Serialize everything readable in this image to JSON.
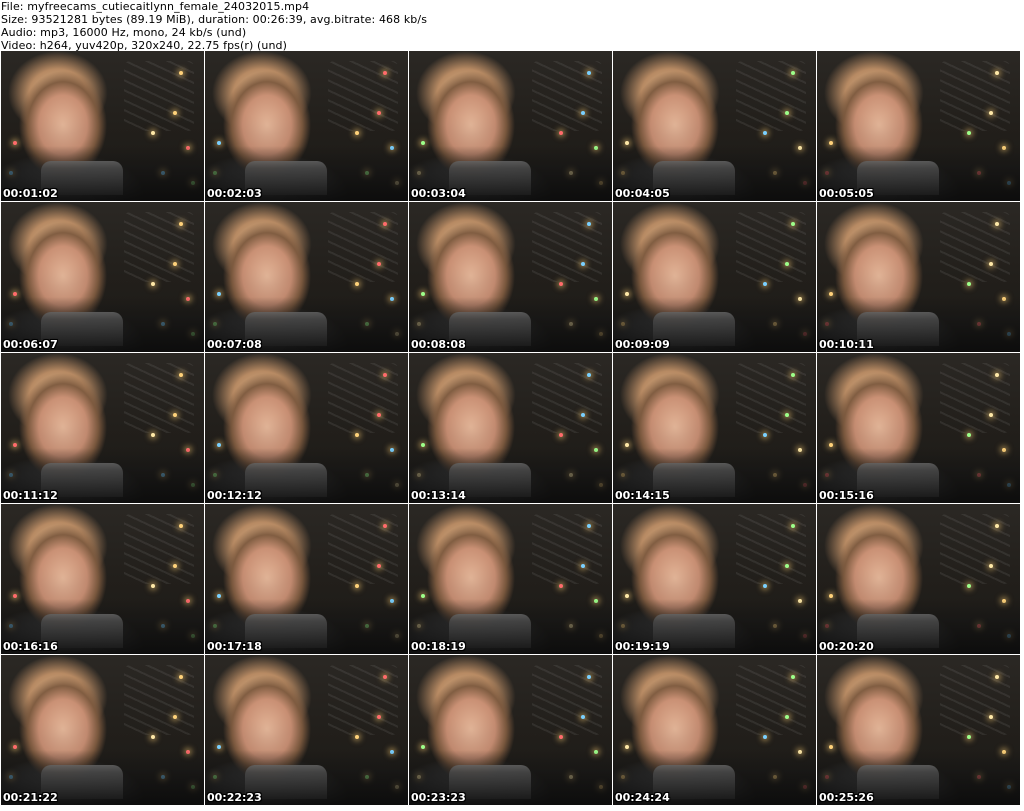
{
  "header": {
    "file": "File: myfreecams_cutiecaitlynn_female_24032015.mp4",
    "size": "Size: 93521281 bytes (89.19 MiB), duration: 00:26:39, avg.bitrate: 468 kb/s",
    "audio": "Audio: mp3, 16000 Hz, mono, 24 kb/s (und)",
    "video": "Video: h264, yuv420p, 320x240, 22.75 fps(r) (und)"
  },
  "thumbnails": [
    {
      "timestamp": "00:01:02"
    },
    {
      "timestamp": "00:02:03"
    },
    {
      "timestamp": "00:03:04"
    },
    {
      "timestamp": "00:04:05"
    },
    {
      "timestamp": "00:05:05"
    },
    {
      "timestamp": "00:06:07"
    },
    {
      "timestamp": "00:07:08"
    },
    {
      "timestamp": "00:08:08"
    },
    {
      "timestamp": "00:09:09"
    },
    {
      "timestamp": "00:10:11"
    },
    {
      "timestamp": "00:11:12"
    },
    {
      "timestamp": "00:12:12"
    },
    {
      "timestamp": "00:13:14"
    },
    {
      "timestamp": "00:14:15"
    },
    {
      "timestamp": "00:15:16"
    },
    {
      "timestamp": "00:16:16"
    },
    {
      "timestamp": "00:17:18"
    },
    {
      "timestamp": "00:18:19"
    },
    {
      "timestamp": "00:19:19"
    },
    {
      "timestamp": "00:20:20"
    },
    {
      "timestamp": "00:21:22"
    },
    {
      "timestamp": "00:22:23"
    },
    {
      "timestamp": "00:23:23"
    },
    {
      "timestamp": "00:24:24"
    },
    {
      "timestamp": "00:25:26"
    }
  ],
  "colors": {
    "background": "#ffffff",
    "header_text": "#000000",
    "timestamp_text": "#ffffff",
    "timestamp_outline": "#000000"
  }
}
